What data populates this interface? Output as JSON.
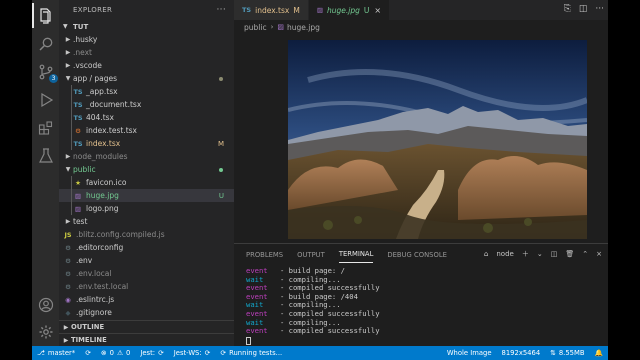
{
  "sidebar": {
    "title": "EXPLORER",
    "more": "···",
    "folder": "TUT",
    "items": [
      {
        "label": ".husky",
        "type": "folder",
        "indent": 1,
        "icon": "folder"
      },
      {
        "label": ".next",
        "type": "folder",
        "indent": 1,
        "icon": "folder",
        "dim": true
      },
      {
        "label": ".vscode",
        "type": "folder",
        "indent": 1,
        "icon": "folder"
      },
      {
        "label": "app / pages",
        "type": "folder-open",
        "indent": 1,
        "icon": "folder",
        "status": "mod-dot"
      },
      {
        "label": "_app.tsx",
        "type": "file",
        "indent": 2,
        "icon": "ts"
      },
      {
        "label": "_document.tsx",
        "type": "file",
        "indent": 2,
        "icon": "ts"
      },
      {
        "label": "404.tsx",
        "type": "file",
        "indent": 2,
        "icon": "ts"
      },
      {
        "label": "index.test.tsx",
        "type": "file",
        "indent": 2,
        "icon": "test"
      },
      {
        "label": "index.tsx",
        "type": "file",
        "indent": 2,
        "icon": "ts",
        "mod": true,
        "status": "M"
      },
      {
        "label": "node_modules",
        "type": "folder",
        "indent": 1,
        "icon": "folder",
        "dim": true
      },
      {
        "label": "public",
        "type": "folder-open",
        "indent": 1,
        "icon": "folder",
        "untracked": true,
        "status": "untracked-dot"
      },
      {
        "label": "favicon.ico",
        "type": "file",
        "indent": 2,
        "icon": "star"
      },
      {
        "label": "huge.jpg",
        "type": "file",
        "indent": 2,
        "icon": "image",
        "untracked": true,
        "status": "U",
        "selected": true
      },
      {
        "label": "logo.png",
        "type": "file",
        "indent": 2,
        "icon": "image"
      },
      {
        "label": "test",
        "type": "folder",
        "indent": 1,
        "icon": "folder"
      },
      {
        "label": ".blitz.config.compiled.js",
        "type": "file",
        "indent": 1,
        "icon": "js",
        "dim": true
      },
      {
        "label": ".editorconfig",
        "type": "file",
        "indent": 1,
        "icon": "gear"
      },
      {
        "label": ".env",
        "type": "file",
        "indent": 1,
        "icon": "gear"
      },
      {
        "label": ".env.local",
        "type": "file",
        "indent": 1,
        "icon": "gear",
        "dim": true
      },
      {
        "label": ".env.test.local",
        "type": "file",
        "indent": 1,
        "icon": "gear",
        "dim": true
      },
      {
        "label": ".eslintrc.js",
        "type": "file",
        "indent": 1,
        "icon": "eslint"
      },
      {
        "label": ".gitignore",
        "type": "file",
        "indent": 1,
        "icon": "git"
      }
    ],
    "outline": "OUTLINE",
    "timeline": "TIMELINE"
  },
  "activity": {
    "scm_badge": "3"
  },
  "tabs": [
    {
      "label": "index.tsx",
      "mark": "M",
      "icon_text": "TS",
      "active": false
    },
    {
      "label": "huge.jpg",
      "mark": "U",
      "icon_text": "▨",
      "active": true,
      "close": "×"
    }
  ],
  "breadcrumb": {
    "folder": "public",
    "file": "huge.jpg"
  },
  "panel": {
    "tabs": [
      "PROBLEMS",
      "OUTPUT",
      "TERMINAL",
      "DEBUG CONSOLE"
    ],
    "active_tab": "TERMINAL",
    "terminal_name": "node",
    "lines": [
      {
        "kw": "event",
        "text": "- build page: /"
      },
      {
        "kw": "wait",
        "text": "- compiling..."
      },
      {
        "kw": "event",
        "text": "- compiled successfully"
      },
      {
        "kw": "event",
        "text": "- build page: /404"
      },
      {
        "kw": "wait",
        "text": "- compiling..."
      },
      {
        "kw": "event",
        "text": "- compiled successfully"
      },
      {
        "kw": "wait",
        "text": "- compiling..."
      },
      {
        "kw": "event",
        "text": "- compiled successfully"
      }
    ]
  },
  "statusbar": {
    "branch": "master*",
    "errors": "0",
    "warnings": "0",
    "jest": "Jest:",
    "jest_ws": "Jest-WS:",
    "running": "Running tests...",
    "zoom": "Whole Image",
    "dimensions": "8192x5464",
    "size": "8.55MB"
  },
  "colors": {
    "accent": "#007acc",
    "modified": "#e2c08d",
    "untracked": "#73c991",
    "ts_icon": "#519aba"
  }
}
